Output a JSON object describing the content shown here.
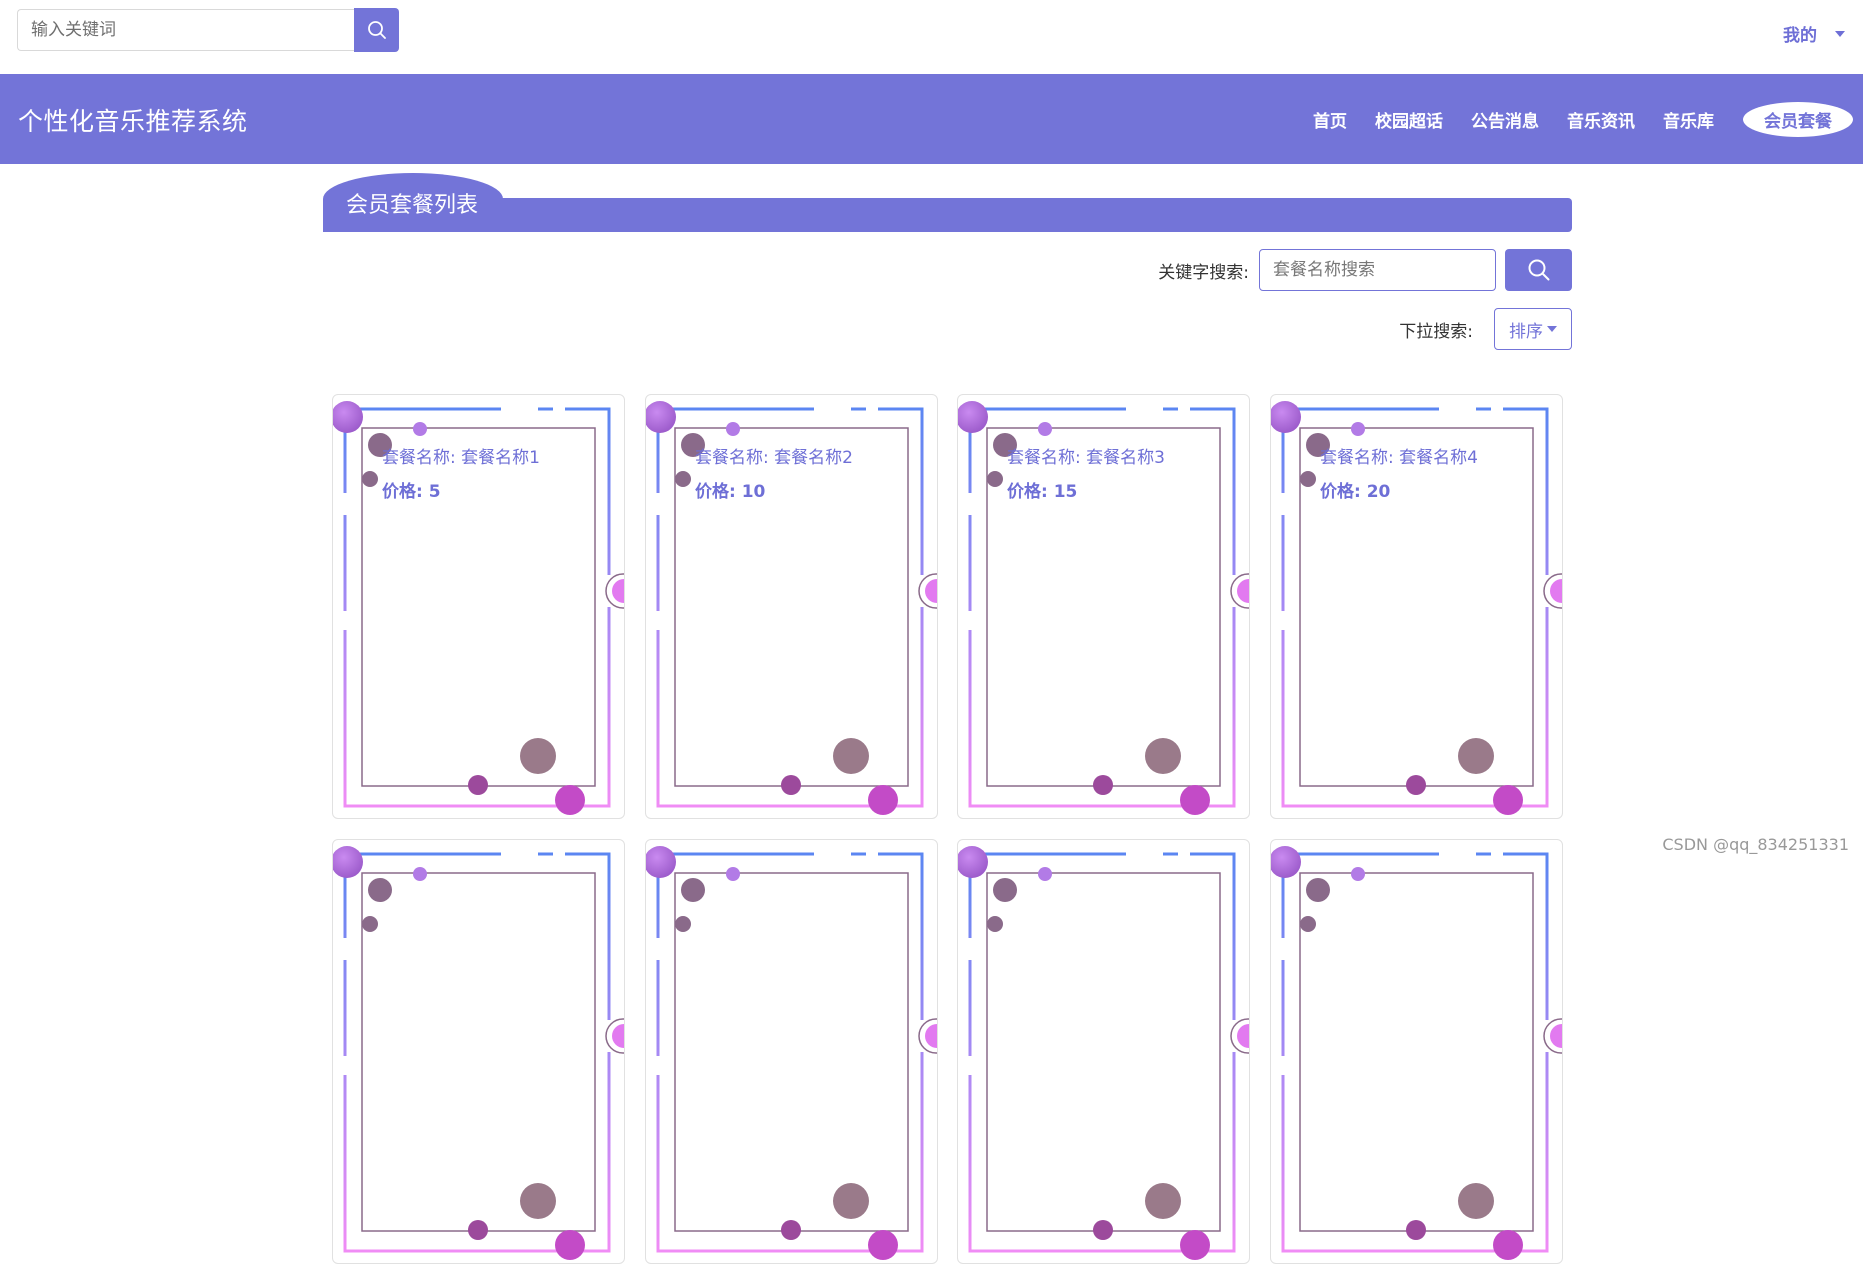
{
  "topbar": {
    "search_placeholder": "输入关键词",
    "user_menu_label": "我的"
  },
  "navbar": {
    "brand": "个性化音乐推荐系统",
    "items": [
      {
        "label": "首页"
      },
      {
        "label": "校园超话"
      },
      {
        "label": "公告消息"
      },
      {
        "label": "音乐资讯"
      },
      {
        "label": "音乐库"
      },
      {
        "label": "会员套餐"
      }
    ],
    "active_label": "会员套餐"
  },
  "section": {
    "title": "会员套餐列表"
  },
  "filters": {
    "keyword_label": "关键字搜索:",
    "keyword_placeholder": "套餐名称搜索",
    "dropdown_label": "下拉搜索:",
    "sort_label": "排序"
  },
  "cards": [
    {
      "name": "套餐名称: 套餐名称1",
      "price": "价格: 5"
    },
    {
      "name": "套餐名称: 套餐名称2",
      "price": "价格: 10"
    },
    {
      "name": "套餐名称: 套餐名称3",
      "price": "价格: 15"
    },
    {
      "name": "套餐名称: 套餐名称4",
      "price": "价格: 20"
    }
  ],
  "watermark": "CSDN @qq_834251331",
  "colors": {
    "primary": "#7374d8",
    "gradient_top": "#5b86f2",
    "gradient_bottom": "#f08cf5"
  },
  "icons": {
    "search": "search-icon",
    "caret": "caret-down-icon"
  }
}
